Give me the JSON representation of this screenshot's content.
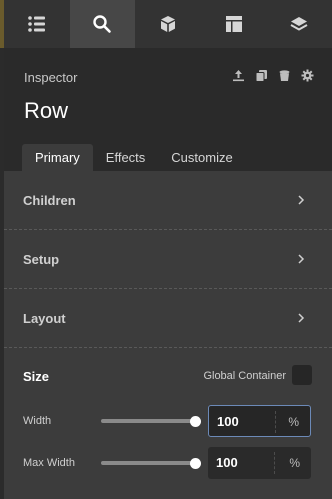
{
  "topbar": {
    "tabs": [
      {
        "icon": "list-icon",
        "active": false
      },
      {
        "icon": "search-icon",
        "active": true
      },
      {
        "icon": "cube-icon",
        "active": false
      },
      {
        "icon": "layout-icon",
        "active": false
      },
      {
        "icon": "layers-icon",
        "active": false
      }
    ]
  },
  "header": {
    "title": "Inspector",
    "element_name": "Row",
    "actions": [
      "move-up-icon",
      "duplicate-icon",
      "delete-icon",
      "settings-icon"
    ],
    "tabs": [
      {
        "label": "Primary",
        "active": true
      },
      {
        "label": "Effects",
        "active": false
      },
      {
        "label": "Customize",
        "active": false
      }
    ]
  },
  "sections": [
    {
      "label": "Children"
    },
    {
      "label": "Setup"
    },
    {
      "label": "Layout"
    }
  ],
  "size": {
    "title": "Size",
    "global_container_label": "Global Container",
    "width": {
      "label": "Width",
      "value": "100",
      "unit": "%",
      "slider_fraction": 1.0
    },
    "max_width": {
      "label": "Max Width",
      "value": "100",
      "unit": "%",
      "slider_fraction": 1.0
    }
  },
  "colors": {
    "background": "#2b2b2b",
    "panel": "#3c3c3c",
    "focus_border": "#6c8ab8"
  }
}
